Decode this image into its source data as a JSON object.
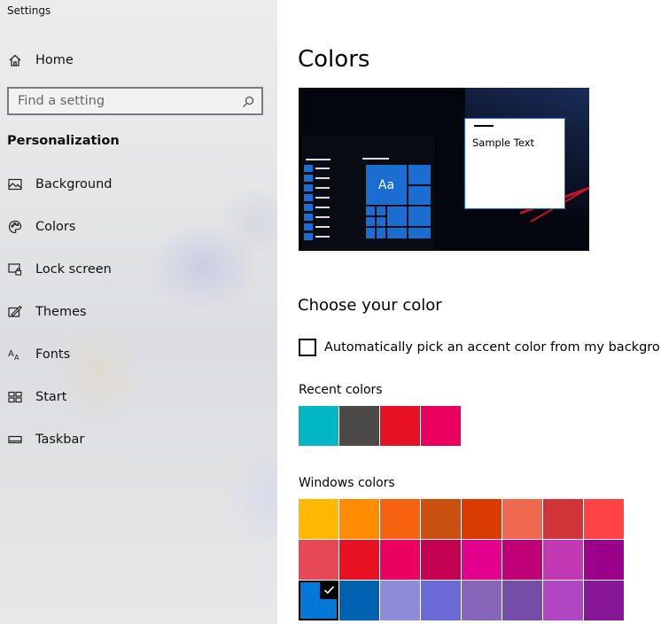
{
  "window": {
    "title": "Settings"
  },
  "sidebar": {
    "home_label": "Home",
    "search_placeholder": "Find a setting",
    "section_heading": "Personalization",
    "items": [
      {
        "label": "Background",
        "icon": "picture-icon"
      },
      {
        "label": "Colors",
        "icon": "palette-icon"
      },
      {
        "label": "Lock screen",
        "icon": "lock-screen-icon"
      },
      {
        "label": "Themes",
        "icon": "brush-icon"
      },
      {
        "label": "Fonts",
        "icon": "fonts-icon"
      },
      {
        "label": "Start",
        "icon": "start-icon"
      },
      {
        "label": "Taskbar",
        "icon": "taskbar-icon"
      }
    ]
  },
  "main": {
    "title": "Colors",
    "preview": {
      "tile_text": "Aa",
      "sample_text": "Sample Text"
    },
    "choose_heading": "Choose your color",
    "auto_accent_label": "Automatically pick an accent color from my background",
    "auto_accent_checked": false,
    "recent_colors_label": "Recent colors",
    "recent_colors": [
      "#00b7c3",
      "#4c4a48",
      "#e81123",
      "#ea005e"
    ],
    "windows_colors_label": "Windows colors",
    "windows_colors": [
      [
        "#ffb900",
        "#ff8c00",
        "#f7630c",
        "#ca5010",
        "#da3b01",
        "#ef6950",
        "#d13438",
        "#ff4343"
      ],
      [
        "#e74856",
        "#e81123",
        "#ea005e",
        "#c30052",
        "#e3008c",
        "#bf0077",
        "#c239b3",
        "#9a0089"
      ],
      [
        "#0078d7",
        "#0063b1",
        "#8e8cd8",
        "#6b69d6",
        "#8764b8",
        "#744da9",
        "#b146c2",
        "#881798"
      ]
    ],
    "selected_color": "#0078d7"
  },
  "theme": {
    "accent": "#1b6ed1"
  }
}
